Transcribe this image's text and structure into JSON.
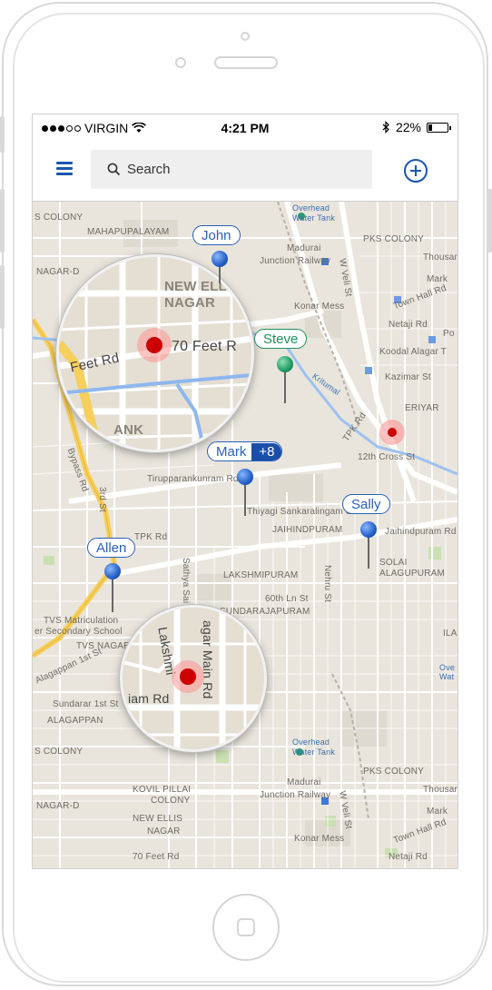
{
  "statusbar": {
    "carrier": "VIRGIN",
    "time": "4:21 PM",
    "battery": "22%",
    "battery_level": 0.22
  },
  "toolbar": {
    "search_placeholder": "Search",
    "menu_icon": "hamburger-menu-icon",
    "add_icon": "add-circle-icon"
  },
  "colors": {
    "accent": "#1a56b0",
    "green_pin": "#1e8f5c",
    "red_marker": "#cc0000",
    "map_bg": "#e9e5dc"
  },
  "pins": [
    {
      "name": "John",
      "color": "blue"
    },
    {
      "name": "Steve",
      "color": "green"
    },
    {
      "name": "Mark",
      "color": "blue",
      "extra": "+8"
    },
    {
      "name": "Sally",
      "color": "blue"
    },
    {
      "name": "Allen",
      "color": "blue"
    }
  ],
  "map_labels": {
    "s_colony": "S COLONY",
    "mahapupalayam": "MAHAPUPALAYAM",
    "nagar_d": "NAGAR-D",
    "overhead": "Overhead",
    "water_tank": "Water Tank",
    "madurai": "Madurai",
    "junction_railway": "Junction Railway",
    "pks_colony": "PKS COLONY",
    "w_veli_st": "W Veli St",
    "thousand": "Thousan",
    "market": "Mark",
    "town_hall": "Town Hall Rd",
    "netaji": "Netaji Rd",
    "konar_mess": "Konar Mess",
    "kudalagar": "Koodal Alagar T",
    "kazimar": "Kazimar St",
    "periyar": "ERIYAR",
    "po": "Po",
    "kritumal": "Kritumal",
    "tpk_rd": "TPK Rd",
    "twelfth_cross": "12th Cross St",
    "bypass": "Bypass Rd",
    "thirupparankunram": "Tirupparankunram Rd",
    "third_st": "3rd St",
    "thiyagi": "Thiyagi Sankaralingam St",
    "jaihindpuram": "JAIHINDPURAM",
    "jaihind_rd": "Jaihindpuram Rd",
    "lakshmipuram": "LAKSHMIPURAM",
    "nehru_st": "Nehru St",
    "solai": "SOLAI",
    "alagupuram": "ALAGUPURAM",
    "sathya_sai": "Sathya Sai Na",
    "sixtieth": "60th Ln St",
    "sundararajapuram": "SUNDARAJAPURAM",
    "tvs_matric": "TVS Matriculation",
    "secondary_school": "er Secondary School",
    "tvs_nagar": "TVS NAGAR",
    "alagappan_1": "Alagappan 1st St",
    "sundarar_1": "Sundarar 1st St",
    "alagappan_nagar": "ALAGAPPAN",
    "kovil_pillai": "KOVIL PILLAI",
    "colony": "COLONY",
    "new_ellis": "NEW ELLIS",
    "nagar": "NAGAR",
    "seventy_feet": "70 Feet Rd",
    "tpk_rd2": "TPK Rd",
    "ilai": "ILAI",
    "ove": "Ove",
    "wat": "Wat"
  },
  "magnifier_top": {
    "label_new_ellis": "NEW ELLI",
    "label_nagar": "NAGAR",
    "label_road": "70 Feet R",
    "label_feet": "Feet Rd",
    "label_ank": "ANK"
  },
  "magnifier_bottom": {
    "label_main": "agar Main Rd",
    "label_lakshmi": "Lakshmi",
    "label_iam": "iam Rd"
  }
}
